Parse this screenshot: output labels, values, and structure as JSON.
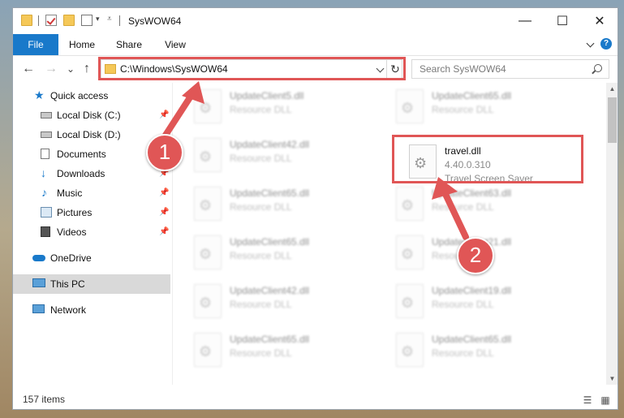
{
  "window": {
    "title": "SysWOW64"
  },
  "window_controls": {
    "minimize": "—",
    "maximize": "☐",
    "close": "✕"
  },
  "ribbon": {
    "tabs": [
      "File",
      "Home",
      "Share",
      "View"
    ],
    "help": "?"
  },
  "nav": {
    "back": "←",
    "forward": "→",
    "recent": "⌄",
    "up": "↑",
    "address": "C:\\Windows\\SysWOW64",
    "refresh": "↻",
    "search_placeholder": "Search SysWOW64"
  },
  "sidebar": {
    "items": [
      {
        "label": "Quick access",
        "icon": "star-icon",
        "pinned": false
      },
      {
        "label": "Local Disk (C:)",
        "icon": "drive-icon",
        "pinned": true
      },
      {
        "label": "Local Disk (D:)",
        "icon": "drive-icon",
        "pinned": false
      },
      {
        "label": "Documents",
        "icon": "documents-icon",
        "pinned": true
      },
      {
        "label": "Downloads",
        "icon": "downloads-icon",
        "pinned": true
      },
      {
        "label": "Music",
        "icon": "music-icon",
        "pinned": true
      },
      {
        "label": "Pictures",
        "icon": "pictures-icon",
        "pinned": true
      },
      {
        "label": "Videos",
        "icon": "videos-icon",
        "pinned": true
      },
      {
        "label": "OneDrive",
        "icon": "onedrive-icon",
        "pinned": false
      },
      {
        "label": "This PC",
        "icon": "pc-icon",
        "pinned": false,
        "selected": true
      },
      {
        "label": "Network",
        "icon": "network-icon",
        "pinned": false
      }
    ]
  },
  "files": {
    "left": [
      {
        "name": "UpdateClient5.dll",
        "type": "Resource DLL"
      },
      {
        "name": "UpdateClient42.dll",
        "type": "Resource DLL"
      },
      {
        "name": "UpdateClient65.dll",
        "type": "Resource DLL"
      },
      {
        "name": "UpdateClient65.dll",
        "type": "Resource DLL"
      },
      {
        "name": "UpdateClient42.dll",
        "type": "Resource DLL"
      },
      {
        "name": "UpdateClient65.dll",
        "type": "Resource DLL"
      }
    ],
    "right": [
      {
        "name": "UpdateClient65.dll",
        "type": "Resource DLL"
      },
      {
        "name": "travel.dll",
        "version": "4.40.0.310",
        "type": "Travel Screen Saver"
      },
      {
        "name": "UpdateClient63.dll",
        "type": "Resource DLL"
      },
      {
        "name": "UpdateClient21.dll",
        "type": "Resource DLL"
      },
      {
        "name": "UpdateClient19.dll",
        "type": "Resource DLL"
      },
      {
        "name": "UpdateClient65.dll",
        "type": "Resource DLL"
      }
    ]
  },
  "status": {
    "count": "157 items"
  },
  "annotations": {
    "step1": "1",
    "step2": "2",
    "color": "#e05656"
  }
}
